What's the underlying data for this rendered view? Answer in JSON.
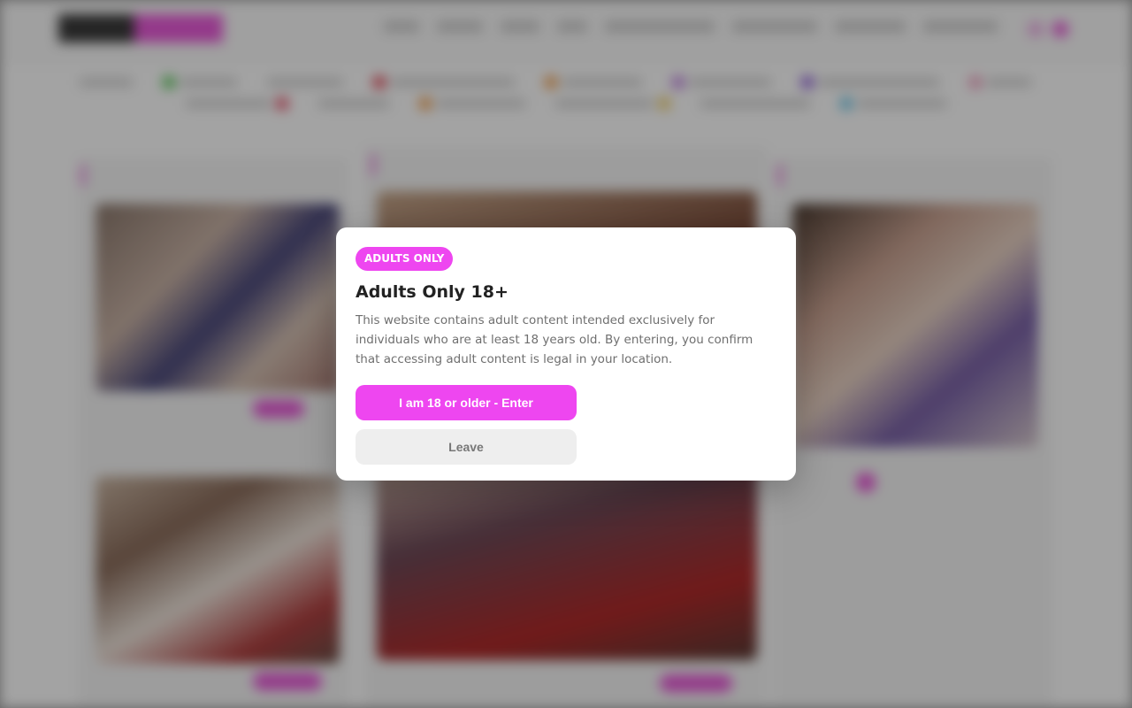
{
  "colors": {
    "accent": "#ee46f0",
    "leave_bg": "#eeeeee",
    "overlay": "rgba(0,0,0,0.36)"
  },
  "modal": {
    "badge": "ADULTS ONLY",
    "title": "Adults Only 18+",
    "text": "This website contains adult content intended exclusively for individuals who are at least 18 years old. By entering, you confirm that accessing adult content is legal in your location.",
    "enter_label": "I am 18 or older - Enter",
    "leave_label": "Leave"
  }
}
